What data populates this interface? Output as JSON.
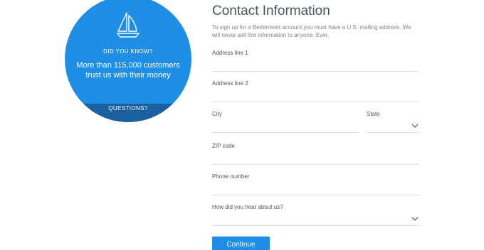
{
  "promo": {
    "boat_icon": "sailboat-icon",
    "heading": "DID YOU KNOW?",
    "fact": "More than 115,000 customers trust us with their money",
    "questions_label": "QUESTIONS?",
    "color": "#1f8ee6",
    "footer_color": "#1a5f9e"
  },
  "form": {
    "title": "Contact Information",
    "intro": "To sign up for a Betterment account you must have a U.S. mailing address. We will never sell this information to anyone. Ever.",
    "address1_label": "Address line 1",
    "address2_label": "Address line 2",
    "city_label": "City",
    "state_label": "State",
    "zip_label": "ZIP code",
    "phone_label": "Phone number",
    "referral_label": "How did you hear about us?",
    "continue_label": "Continue",
    "accent": "#1f8ee6"
  }
}
